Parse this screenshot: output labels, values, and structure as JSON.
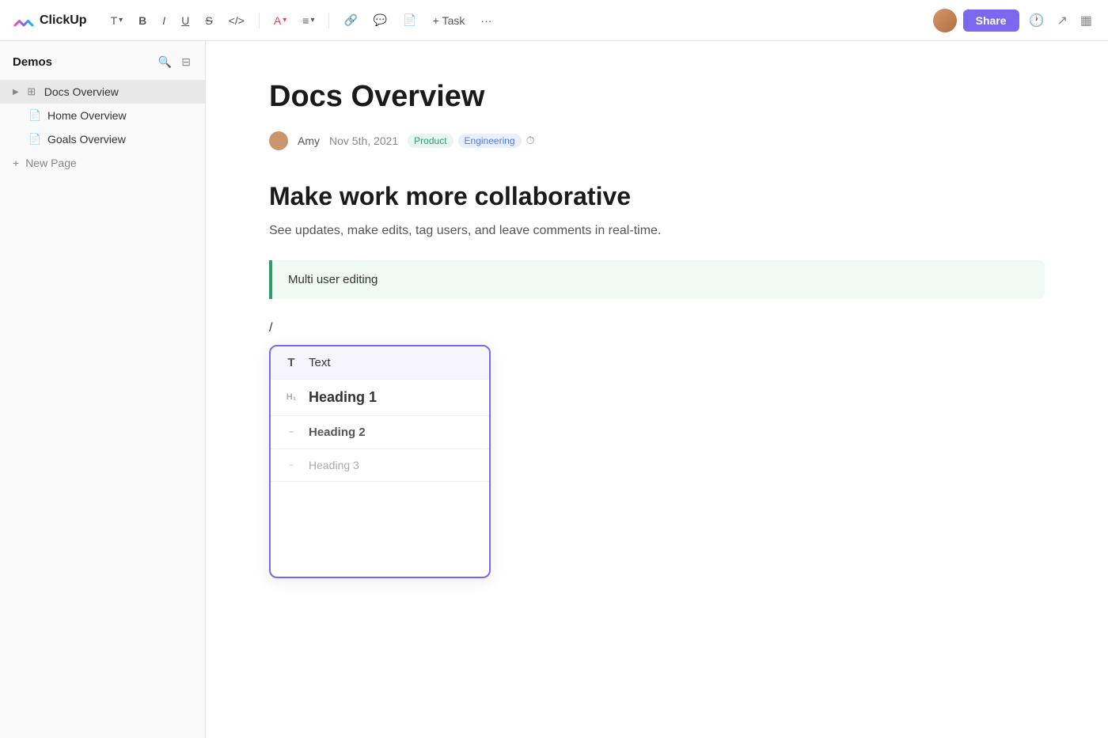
{
  "app": {
    "logo_text": "ClickUp"
  },
  "toolbar": {
    "text_format": "T",
    "bold": "B",
    "italic": "I",
    "underline": "U",
    "strikethrough": "S",
    "code": "</>",
    "color": "A",
    "align": "≡",
    "link": "🔗",
    "comment": "💬",
    "doc": "📄",
    "task": "+ Task",
    "more": "···",
    "share_label": "Share"
  },
  "sidebar": {
    "workspace_name": "Demos",
    "items": [
      {
        "label": "Docs Overview",
        "icon": "grid",
        "active": true
      },
      {
        "label": "Home Overview",
        "icon": "doc"
      },
      {
        "label": "Goals Overview",
        "icon": "doc"
      }
    ],
    "new_page_label": "New Page"
  },
  "document": {
    "title": "Docs Overview",
    "author": "Amy",
    "date": "Nov 5th, 2021",
    "tags": [
      {
        "label": "Product",
        "type": "product"
      },
      {
        "label": "Engineering",
        "type": "engineering"
      }
    ],
    "heading": "Make work more collaborative",
    "subtitle": "See updates, make edits, tag users, and leave comments in real-time.",
    "blockquote": "Multi user editing",
    "slash_char": "/",
    "command_items": [
      {
        "icon": "T",
        "label": "Text",
        "style": "text"
      },
      {
        "icon": "H₁",
        "label": "Heading 1",
        "style": "h1"
      },
      {
        "icon": "–",
        "label": "Heading 2",
        "style": "h2"
      },
      {
        "icon": "–",
        "label": "Heading 3",
        "style": "h3"
      }
    ]
  }
}
